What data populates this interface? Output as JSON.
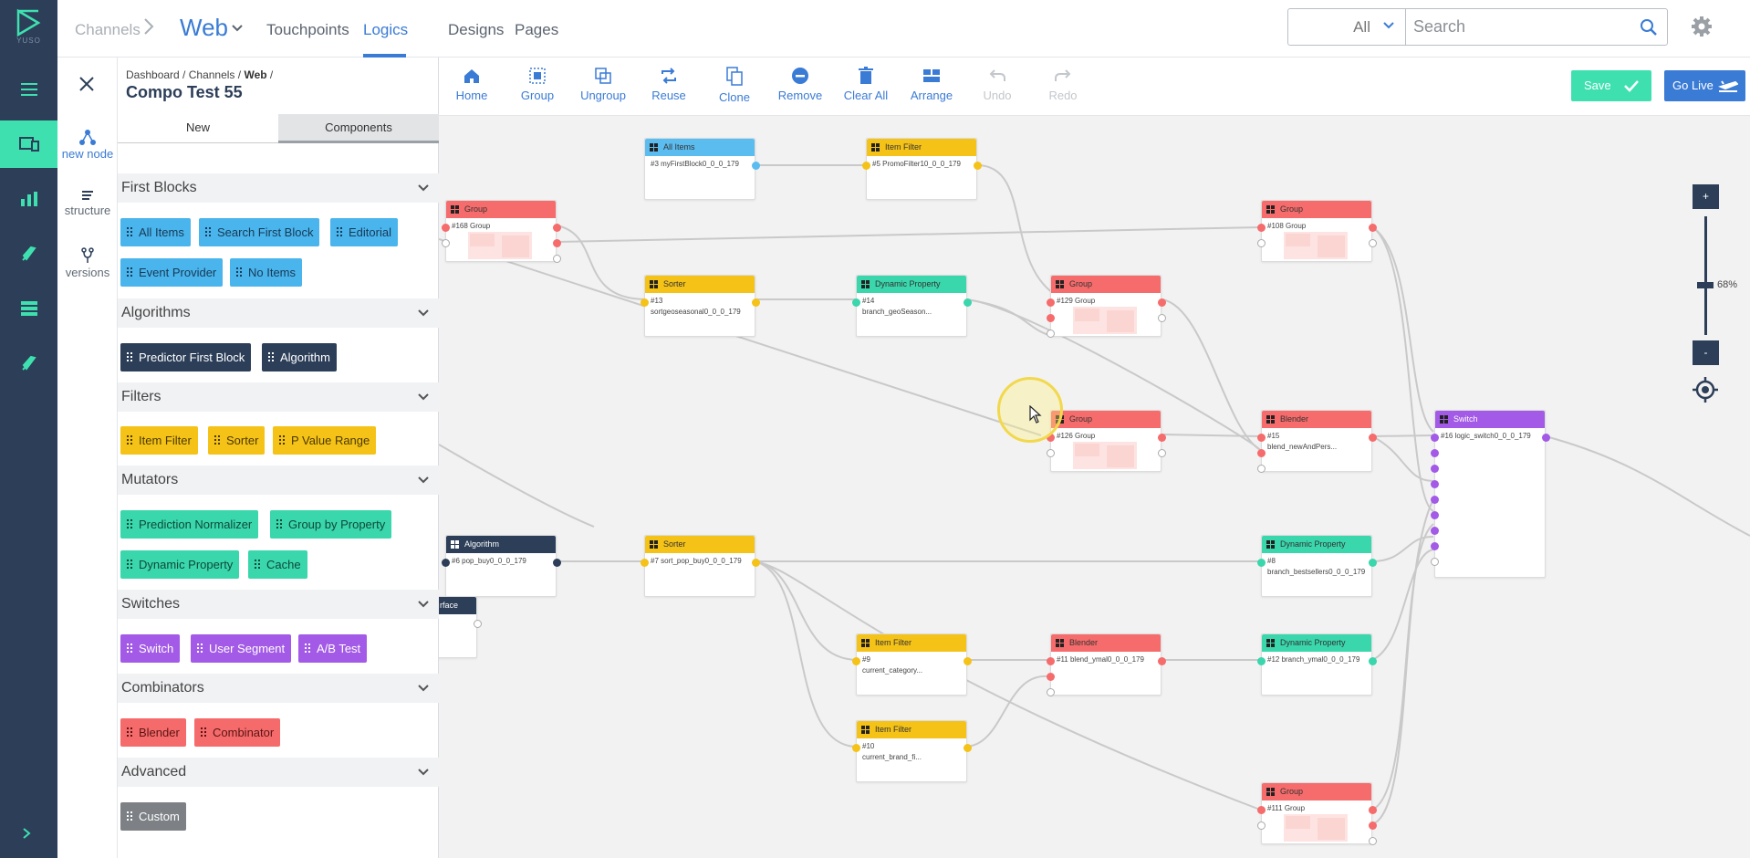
{
  "brand": {
    "logo_text": "YUSO"
  },
  "topbar": {
    "breadcrumb_root": "Channels",
    "channel": "Web",
    "tabs": [
      "Touchpoints",
      "Logics",
      "Designs",
      "Pages"
    ],
    "active_tab": "Logics",
    "search_scope": "All",
    "search_placeholder": "Search"
  },
  "rail": {
    "items": [
      "menu-icon",
      "channels-icon",
      "analytics-icon",
      "rocket-icon",
      "database-icon",
      "rocket-icon"
    ],
    "active_index": 1
  },
  "icon_column": {
    "items": [
      {
        "label": "new node",
        "icon": "new-node-icon"
      },
      {
        "label": "structure",
        "icon": "structure-icon"
      },
      {
        "label": "versions",
        "icon": "versions-icon"
      }
    ]
  },
  "panel": {
    "breadcrumb": {
      "a": "Dashboard",
      "b": "Channels",
      "c": "Web"
    },
    "title": "Compo Test 55",
    "tabs": {
      "new": "New",
      "components": "Components"
    },
    "categories": [
      {
        "name": "First Blocks",
        "chips": [
          "All Items",
          "Search First Block",
          "Editorial",
          "Event Provider",
          "No Items"
        ]
      },
      {
        "name": "Algorithms",
        "chips": [
          "Predictor First Block",
          "Algorithm"
        ]
      },
      {
        "name": "Filters",
        "chips": [
          "Item Filter",
          "Sorter",
          "P Value Range"
        ]
      },
      {
        "name": "Mutators",
        "chips": [
          "Prediction Normalizer",
          "Group by Property",
          "Dynamic Property",
          "Cache"
        ]
      },
      {
        "name": "Switches",
        "chips": [
          "Switch",
          "User Segment",
          "A/B Test"
        ]
      },
      {
        "name": "Combinators",
        "chips": [
          "Blender",
          "Combinator"
        ]
      },
      {
        "name": "Advanced",
        "chips": [
          "Custom"
        ]
      }
    ]
  },
  "toolbar": {
    "buttons": [
      "Home",
      "Group",
      "Ungroup",
      "Reuse",
      "Clone",
      "Remove",
      "Clear All",
      "Arrange",
      "Undo",
      "Redo"
    ],
    "disabled": [
      "Undo",
      "Redo"
    ],
    "save": "Save",
    "go_live": "Go Live"
  },
  "colors": {
    "accent": "#3a7bd5",
    "save": "#3fe0b0",
    "rail": "#2c3e58"
  },
  "nodes": [
    {
      "id": "n-allitems",
      "type": "All Items",
      "color": "blue",
      "lines": [
        "#3 myFirstBlock0_0_0_179"
      ]
    },
    {
      "id": "n-itemfilter5",
      "type": "Item Filter",
      "color": "yellow",
      "lines": [
        "#5 PromoFilter10_0_0_179"
      ]
    },
    {
      "id": "n-group168",
      "type": "Group",
      "color": "red",
      "lines": [
        "#168 Group"
      ]
    },
    {
      "id": "n-group108",
      "type": "Group",
      "color": "red",
      "lines": [
        "#108 Group"
      ]
    },
    {
      "id": "n-sorter13",
      "type": "Sorter",
      "color": "yellow",
      "lines": [
        "#13",
        "sortgeoseasonal0_0_0_179"
      ]
    },
    {
      "id": "n-dynprop14",
      "type": "Dynamic Property",
      "color": "teal",
      "lines": [
        "#14",
        "branch_geoSeason..."
      ]
    },
    {
      "id": "n-group129",
      "type": "Group",
      "color": "red",
      "lines": [
        "#129 Group"
      ]
    },
    {
      "id": "n-group126",
      "type": "Group",
      "color": "red",
      "lines": [
        "#126 Group"
      ]
    },
    {
      "id": "n-blender15",
      "type": "Blender",
      "color": "red",
      "lines": [
        "#15",
        "blend_newAndPers..."
      ]
    },
    {
      "id": "n-switch16",
      "type": "Switch",
      "color": "purple",
      "lines": [
        "#16 logic_switch0_0_0_179"
      ]
    },
    {
      "id": "n-algo6",
      "type": "Algorithm",
      "color": "navy",
      "lines": [
        "#6 pop_buy0_0_0_179"
      ]
    },
    {
      "id": "n-sorter7",
      "type": "Sorter",
      "color": "yellow",
      "lines": [
        "#7 sort_pop_buy0_0_0_179"
      ]
    },
    {
      "id": "n-dynprop8",
      "type": "Dynamic Property",
      "color": "teal",
      "lines": [
        "#8",
        "branch_bestsellers0_0_0_179"
      ]
    },
    {
      "id": "n-interface",
      "type": "rface",
      "color": "navy",
      "lines": []
    },
    {
      "id": "n-itemfilter9",
      "type": "Item Filter",
      "color": "yellow",
      "lines": [
        "#9",
        "current_category..."
      ]
    },
    {
      "id": "n-blender11",
      "type": "Blender",
      "color": "red",
      "lines": [
        "#11 blend_ymal0_0_0_179"
      ]
    },
    {
      "id": "n-dynprop12",
      "type": "Dynamic Property",
      "color": "teal",
      "lines": [
        "#12 branch_ymal0_0_0_179"
      ]
    },
    {
      "id": "n-itemfilter10",
      "type": "Item Filter",
      "color": "yellow",
      "lines": [
        "#10",
        "current_brand_fi..."
      ]
    },
    {
      "id": "n-group111",
      "type": "Group",
      "color": "red",
      "lines": [
        "#111 Group"
      ]
    }
  ],
  "zoom": {
    "plus": "+",
    "minus": "-",
    "level": "68%"
  }
}
